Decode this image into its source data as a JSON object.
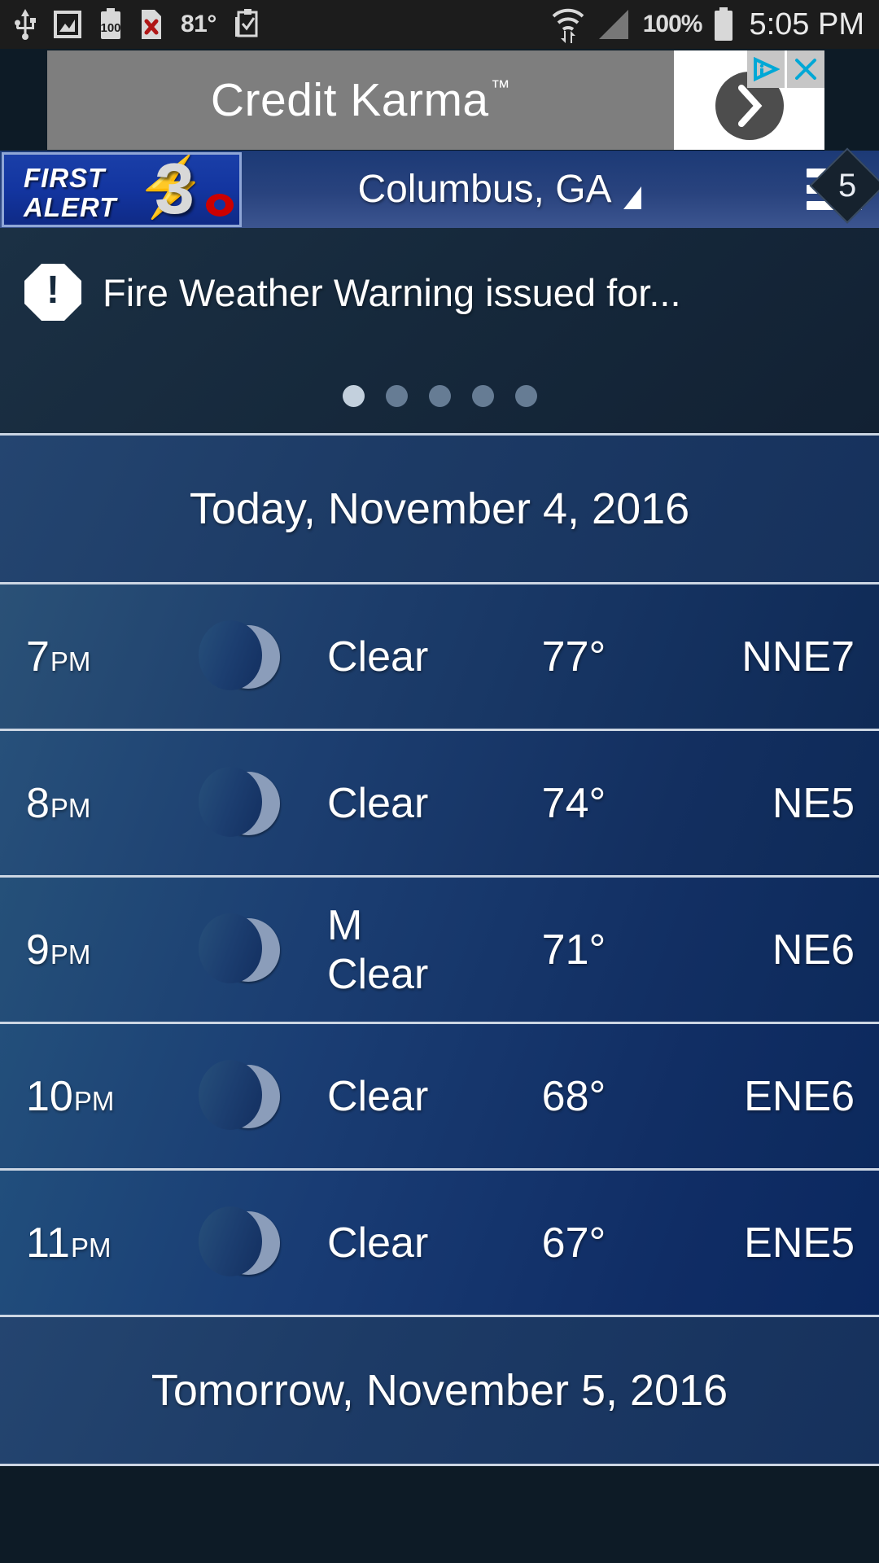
{
  "status_bar": {
    "icons": [
      "usb-icon",
      "screenshot-icon",
      "battery-100-icon",
      "sim-error-icon",
      "clipboard-check-icon"
    ],
    "temperature": "81°",
    "battery_percent": "100%",
    "time": "5:05 PM",
    "wifi_icon": "wifi-icon",
    "signal_icon": "signal-icon",
    "battery_icon": "battery-icon"
  },
  "ad": {
    "text": "Credit Karma",
    "trademark": "™",
    "arrow": "›",
    "adchoices_icon": "adchoices-icon",
    "close_icon": "×"
  },
  "header": {
    "logo": {
      "first": "FIRST",
      "alert": "ALERT",
      "channel": "3",
      "bolt_icon": "lightning-bolt-icon",
      "eye_icon": "cbs-eye-icon"
    },
    "location": "Columbus, GA",
    "location_caret_icon": "dropdown-caret-icon",
    "menu_icon": "hamburger-menu-icon",
    "menu_badge_count": "5"
  },
  "alert": {
    "icon": "warning-octagon-icon",
    "exclamation": "!",
    "text": "Fire Weather Warning issued for...",
    "carousel": {
      "total": 5,
      "active_index": 0
    }
  },
  "forecast": {
    "today_header": "Today, November 4, 2016",
    "tomorrow_header": "Tomorrow, November 5, 2016",
    "hours": [
      {
        "hour": "7",
        "ampm": "PM",
        "icon": "moon-icon",
        "condition": "Clear",
        "temp": "77°",
        "wind": "NNE7"
      },
      {
        "hour": "8",
        "ampm": "PM",
        "icon": "moon-icon",
        "condition": "Clear",
        "temp": "74°",
        "wind": "NE5"
      },
      {
        "hour": "9",
        "ampm": "PM",
        "icon": "moon-icon",
        "condition": "M Clear",
        "temp": "71°",
        "wind": "NE6"
      },
      {
        "hour": "10",
        "ampm": "PM",
        "icon": "moon-icon",
        "condition": "Clear",
        "temp": "68°",
        "wind": "ENE6"
      },
      {
        "hour": "11",
        "ampm": "PM",
        "icon": "moon-icon",
        "condition": "Clear",
        "temp": "67°",
        "wind": "ENE5"
      }
    ]
  },
  "colors": {
    "brand_blue": "#1335a0",
    "header_blue": "#29437e",
    "row_blue": "#1e3f6d",
    "divider": "#ccd6e3",
    "accent_cyan": "#00a8d6",
    "bolt_yellow": "#f5b50a",
    "cbs_red": "#cc0000"
  }
}
